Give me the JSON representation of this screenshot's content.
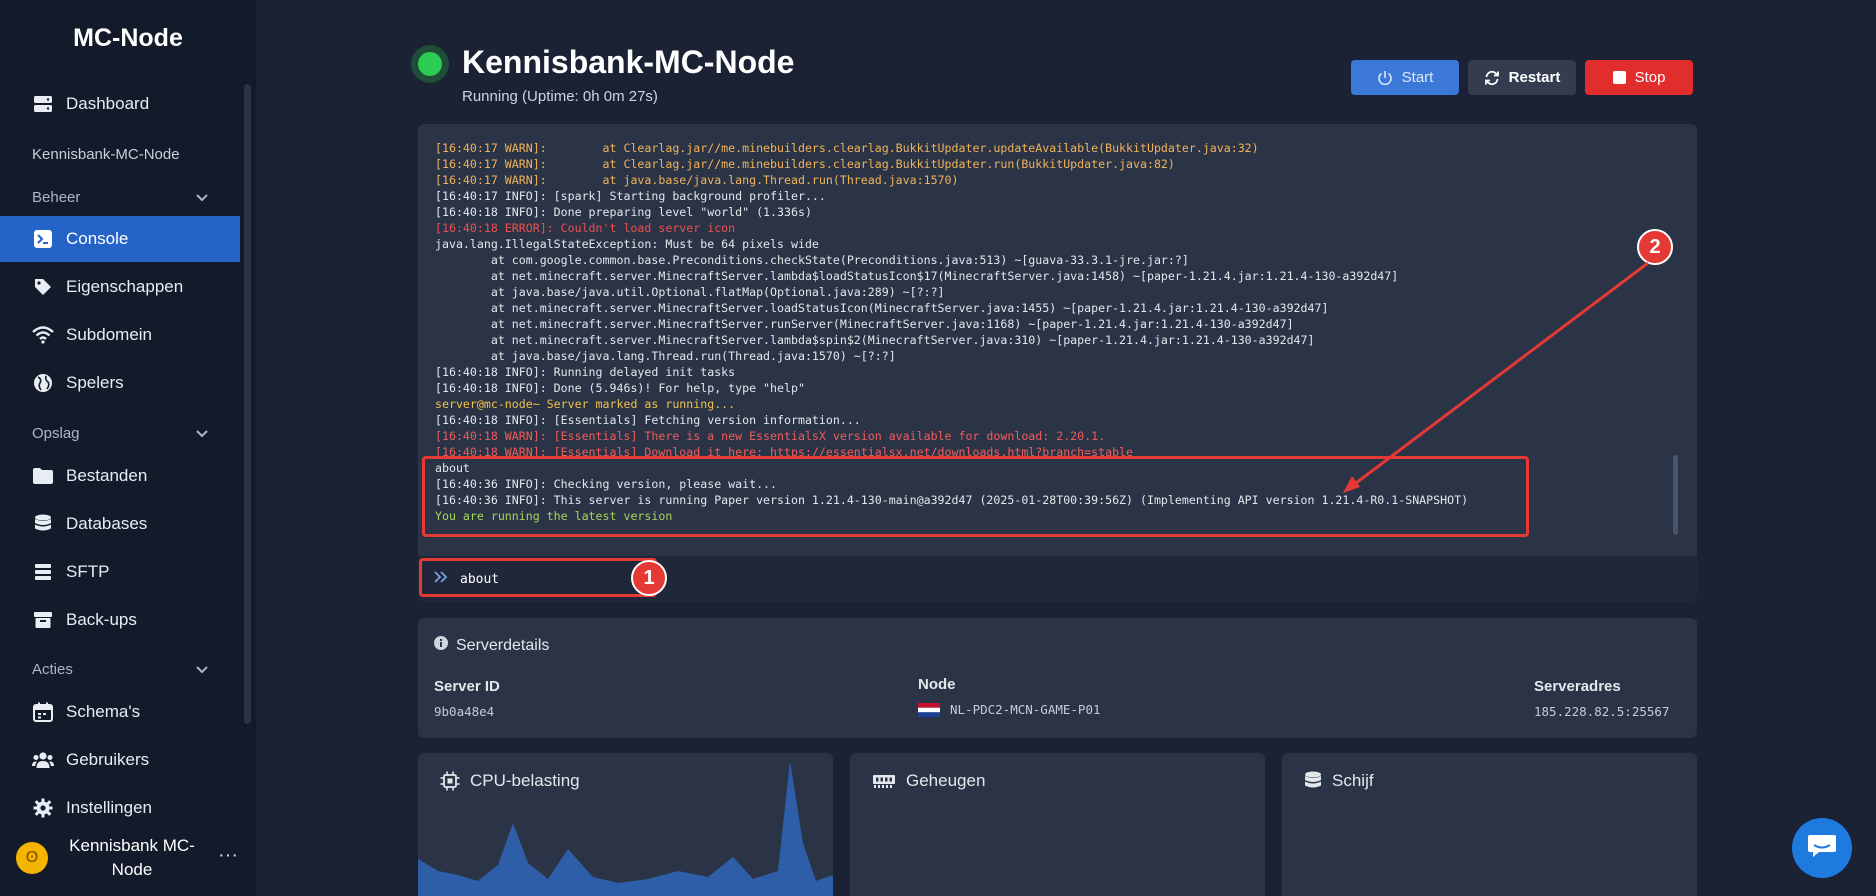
{
  "sidebar": {
    "brand": "MC-Node",
    "dashboard": "Dashboard",
    "server_name": "Kennisbank-MC-Node",
    "sections": {
      "beheer": "Beheer",
      "opslag": "Opslag",
      "acties": "Acties"
    },
    "items": {
      "console": "Console",
      "eigenschappen": "Eigenschappen",
      "subdomein": "Subdomein",
      "spelers": "Spelers",
      "bestanden": "Bestanden",
      "databases": "Databases",
      "sftp": "SFTP",
      "backups": "Back-ups",
      "schemas": "Schema's",
      "gebruikers": "Gebruikers",
      "instellingen": "Instellingen"
    },
    "user": {
      "name": "Kennisbank MC-Node",
      "more": "···"
    }
  },
  "header": {
    "title": "Kennisbank-MC-Node",
    "status": "Running (Uptime: 0h 0m 27s)",
    "buttons": {
      "start": "Start",
      "restart": "Restart",
      "stop": "Stop"
    }
  },
  "console": {
    "lines": [
      {
        "text": "[16:40:17 WARN]:        at Clearlag.jar//me.minebuilders.clearlag.BukkitUpdater.updateAvailable(BukkitUpdater.java:32)",
        "kind": "warn"
      },
      {
        "text": "[16:40:17 WARN]:        at Clearlag.jar//me.minebuilders.clearlag.BukkitUpdater.run(BukkitUpdater.java:82)",
        "kind": "warn"
      },
      {
        "text": "[16:40:17 WARN]:        at java.base/java.lang.Thread.run(Thread.java:1570)",
        "kind": "warn"
      },
      {
        "text": "[16:40:17 INFO]: [spark] Starting background profiler...",
        "kind": "info"
      },
      {
        "text": "[16:40:18 INFO]: Done preparing level \"world\" (1.336s)",
        "kind": "info"
      },
      {
        "text": "[16:40:18 ERROR]: Couldn't load server icon",
        "kind": "error"
      },
      {
        "text": "java.lang.IllegalStateException: Must be 64 pixels wide",
        "kind": "info"
      },
      {
        "text": "        at com.google.common.base.Preconditions.checkState(Preconditions.java:513) ~[guava-33.3.1-jre.jar:?]",
        "kind": "info"
      },
      {
        "text": "        at net.minecraft.server.MinecraftServer.lambda$loadStatusIcon$17(MinecraftServer.java:1458) ~[paper-1.21.4.jar:1.21.4-130-a392d47]",
        "kind": "info"
      },
      {
        "text": "        at java.base/java.util.Optional.flatMap(Optional.java:289) ~[?:?]",
        "kind": "info"
      },
      {
        "text": "        at net.minecraft.server.MinecraftServer.loadStatusIcon(MinecraftServer.java:1455) ~[paper-1.21.4.jar:1.21.4-130-a392d47]",
        "kind": "info"
      },
      {
        "text": "        at net.minecraft.server.MinecraftServer.runServer(MinecraftServer.java:1168) ~[paper-1.21.4.jar:1.21.4-130-a392d47]",
        "kind": "info"
      },
      {
        "text": "        at net.minecraft.server.MinecraftServer.lambda$spin$2(MinecraftServer.java:310) ~[paper-1.21.4.jar:1.21.4-130-a392d47]",
        "kind": "info"
      },
      {
        "text": "        at java.base/java.lang.Thread.run(Thread.java:1570) ~[?:?]",
        "kind": "info"
      },
      {
        "text": "[16:40:18 INFO]: Running delayed init tasks",
        "kind": "info"
      },
      {
        "text": "[16:40:18 INFO]: Done (5.946s)! For help, type \"help\"",
        "kind": "info"
      },
      {
        "text": "server@mc-node~ Server marked as running...",
        "kind": "prompt"
      },
      {
        "text": "[16:40:18 INFO]: [Essentials] Fetching version information...",
        "kind": "info"
      },
      {
        "text": "[16:40:18 WARN]: [Essentials] There is a new EssentialsX version available for download: 2.20.1.",
        "kind": "red2"
      },
      {
        "text": "[16:40:18 WARN]: [Essentials] Download it here: https://essentialsx.net/downloads.html?branch=stable",
        "kind": "red2"
      },
      {
        "text": "about",
        "kind": "info"
      },
      {
        "text": "[16:40:36 INFO]: Checking version, please wait...",
        "kind": "info"
      },
      {
        "text": "[16:40:36 INFO]: This server is running Paper version 1.21.4-130-main@a392d47 (2025-01-28T00:39:56Z) (Implementing API version 1.21.4-R0.1-SNAPSHOT)",
        "kind": "info"
      },
      {
        "text": "You are running the latest version",
        "kind": "green"
      }
    ],
    "input_value": "about",
    "prompt_icon": "chevrons-right-icon"
  },
  "annotations": {
    "badge1": "1",
    "badge2": "2",
    "color": "#e53935"
  },
  "details": {
    "title": "Serverdetails",
    "server_id_label": "Server ID",
    "server_id": "9b0a48e4",
    "node_label": "Node",
    "node": "NL-PDC2-MCN-GAME-P01",
    "address_label": "Serveradres",
    "address": "185.228.82.5:25567"
  },
  "cards": {
    "cpu": "CPU-belasting",
    "memory": "Geheugen",
    "disk": "Schijf"
  },
  "colors": {
    "accent": "#2563c9",
    "running": "#2ecc52",
    "stop": "#e22d2d",
    "start": "#3c78d8"
  }
}
